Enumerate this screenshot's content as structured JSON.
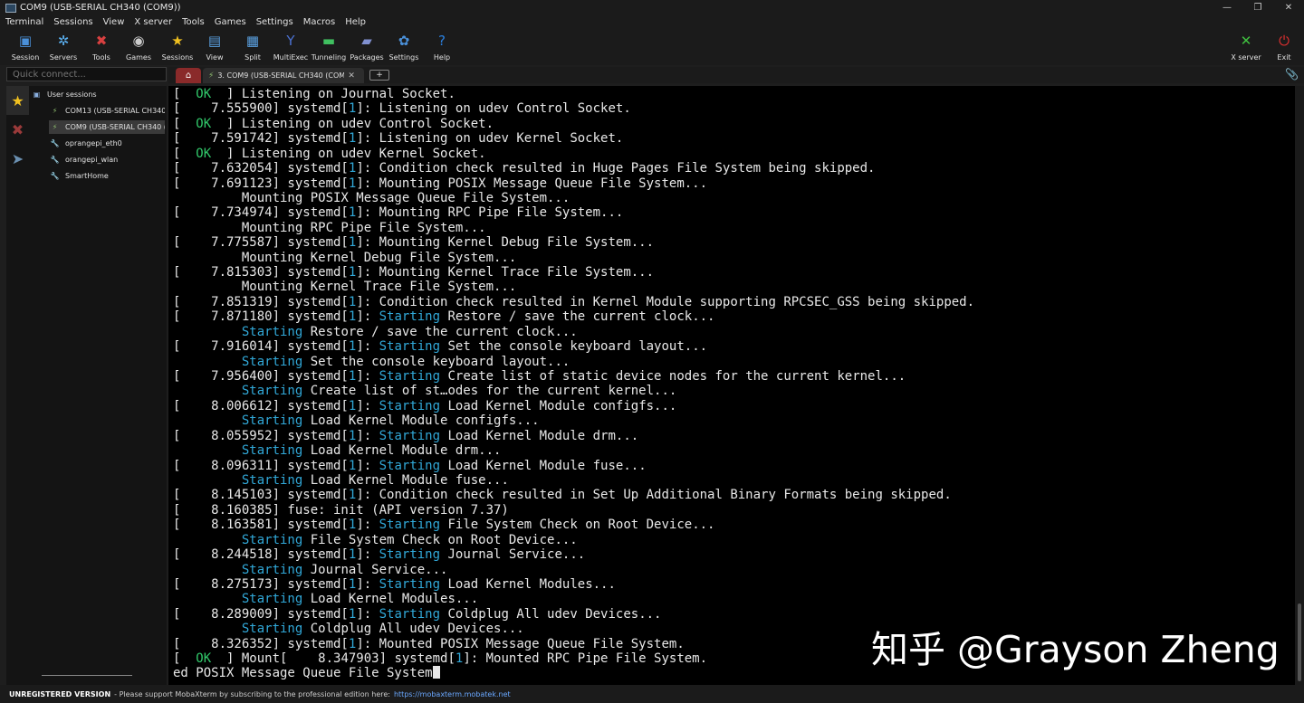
{
  "window": {
    "title": "COM9  (USB-SERIAL CH340 (COM9))",
    "controls": [
      "—",
      "❐",
      "✕"
    ]
  },
  "menu": [
    "Terminal",
    "Sessions",
    "View",
    "X server",
    "Tools",
    "Games",
    "Settings",
    "Macros",
    "Help"
  ],
  "toolbar": {
    "buttons": [
      {
        "label": "Session",
        "icon": "session-icon",
        "color": "#4a90d9",
        "glyph": "▣"
      },
      {
        "label": "Servers",
        "icon": "servers-icon",
        "color": "#5ab0f0",
        "glyph": "✲"
      },
      {
        "label": "Tools",
        "icon": "tools-icon",
        "color": "#d84040",
        "glyph": "✖"
      },
      {
        "label": "Games",
        "icon": "games-icon",
        "color": "#cccccc",
        "glyph": "◉"
      },
      {
        "label": "Sessions",
        "icon": "star-icon",
        "color": "#f0c020",
        "glyph": "★"
      },
      {
        "label": "View",
        "icon": "view-icon",
        "color": "#5aa0e0",
        "glyph": "▤"
      },
      {
        "label": "Split",
        "icon": "split-icon",
        "color": "#5aa0e0",
        "glyph": "▦"
      },
      {
        "label": "MultiExec",
        "icon": "multiexec-icon",
        "color": "#4a70d0",
        "glyph": "Y"
      },
      {
        "label": "Tunneling",
        "icon": "tunneling-icon",
        "color": "#40c060",
        "glyph": "▬"
      },
      {
        "label": "Packages",
        "icon": "packages-icon",
        "color": "#8090d0",
        "glyph": "▰"
      },
      {
        "label": "Settings",
        "icon": "settings-icon",
        "color": "#4a90d9",
        "glyph": "✿"
      },
      {
        "label": "Help",
        "icon": "help-icon",
        "color": "#2a80e0",
        "glyph": "?"
      }
    ],
    "right_buttons": [
      {
        "label": "X server",
        "icon": "xserver-icon",
        "color": "#40c040",
        "glyph": "✕"
      },
      {
        "label": "Exit",
        "icon": "exit-icon",
        "color": "#e03030",
        "glyph": "⏻"
      }
    ]
  },
  "sidebar": {
    "quick_connect_placeholder": "Quick connect...",
    "tabs": [
      {
        "name": "sidetab-sessions",
        "icon": "star-icon",
        "glyph": "★",
        "color": "#f0c020"
      },
      {
        "name": "sidetab-tools",
        "icon": "tools-icon",
        "glyph": "✖",
        "color": "#9a3a3a"
      },
      {
        "name": "sidetab-send",
        "icon": "send-icon",
        "glyph": "➤",
        "color": "#6a8fb0"
      }
    ],
    "tree": [
      {
        "label": "User sessions",
        "icon": "folder-icon",
        "glyph": "▣",
        "color": "#8ab0e0",
        "indent": 0
      },
      {
        "label": "COM13  (USB-SERIAL CH340 (COM13))",
        "icon": "serial-icon",
        "glyph": "⚡",
        "color": "#8fbf6f",
        "indent": 1
      },
      {
        "label": "COM9  (USB-SERIAL CH340 (COM9))",
        "icon": "serial-icon",
        "glyph": "⚡",
        "color": "#8fbf6f",
        "indent": 1,
        "selected": true
      },
      {
        "label": "oprangepi_eth0",
        "icon": "ssh-icon",
        "glyph": "🔧",
        "color": "#e0b030",
        "indent": 1
      },
      {
        "label": "orangepi_wlan",
        "icon": "ssh-icon",
        "glyph": "🔧",
        "color": "#e0b030",
        "indent": 1
      },
      {
        "label": "SmartHome",
        "icon": "ssh-icon",
        "glyph": "🔧",
        "color": "#e0b030",
        "indent": 1
      }
    ]
  },
  "tabs": {
    "session_tab_label": "3. COM9  (USB-SERIAL CH340 (COM9))",
    "close": "✕",
    "new_tab": "+"
  },
  "terminal": {
    "lines": [
      [
        {
          "t": "[  "
        },
        {
          "t": "OK",
          "c": "ok"
        },
        {
          "t": "  ] Listening on Journal Socket."
        }
      ],
      [
        {
          "t": "[    7.555900] systemd["
        },
        {
          "t": "1",
          "c": "num"
        },
        {
          "t": "]: Listening on udev Control Socket."
        }
      ],
      [
        {
          "t": "[  "
        },
        {
          "t": "OK",
          "c": "ok"
        },
        {
          "t": "  ] Listening on udev Control Socket."
        }
      ],
      [
        {
          "t": "[    7.591742] systemd["
        },
        {
          "t": "1",
          "c": "num"
        },
        {
          "t": "]: Listening on udev Kernel Socket."
        }
      ],
      [
        {
          "t": "[  "
        },
        {
          "t": "OK",
          "c": "ok"
        },
        {
          "t": "  ] Listening on udev Kernel Socket."
        }
      ],
      [
        {
          "t": "[    7.632054] systemd["
        },
        {
          "t": "1",
          "c": "num"
        },
        {
          "t": "]: Condition check resulted in Huge Pages File System being skipped."
        }
      ],
      [
        {
          "t": "[    7.691123] systemd["
        },
        {
          "t": "1",
          "c": "num"
        },
        {
          "t": "]: Mounting POSIX Message Queue File System..."
        }
      ],
      [
        {
          "t": "         Mounting POSIX Message Queue File System..."
        }
      ],
      [
        {
          "t": "[    7.734974] systemd["
        },
        {
          "t": "1",
          "c": "num"
        },
        {
          "t": "]: Mounting RPC Pipe File System..."
        }
      ],
      [
        {
          "t": "         Mounting RPC Pipe File System..."
        }
      ],
      [
        {
          "t": "[    7.775587] systemd["
        },
        {
          "t": "1",
          "c": "num"
        },
        {
          "t": "]: Mounting Kernel Debug File System..."
        }
      ],
      [
        {
          "t": "         Mounting Kernel Debug File System..."
        }
      ],
      [
        {
          "t": "[    7.815303] systemd["
        },
        {
          "t": "1",
          "c": "num"
        },
        {
          "t": "]: Mounting Kernel Trace File System..."
        }
      ],
      [
        {
          "t": "         Mounting Kernel Trace File System..."
        }
      ],
      [
        {
          "t": "[    7.851319] systemd["
        },
        {
          "t": "1",
          "c": "num"
        },
        {
          "t": "]: Condition check resulted in Kernel Module supporting RPCSEC_GSS being skipped."
        }
      ],
      [
        {
          "t": "[    7.871180] systemd["
        },
        {
          "t": "1",
          "c": "num"
        },
        {
          "t": "]: "
        },
        {
          "t": "Starting",
          "c": "cyan"
        },
        {
          "t": " Restore / save the current clock..."
        }
      ],
      [
        {
          "t": "         "
        },
        {
          "t": "Starting",
          "c": "cyan"
        },
        {
          "t": " Restore / save the current clock..."
        }
      ],
      [
        {
          "t": "[    7.916014] systemd["
        },
        {
          "t": "1",
          "c": "num"
        },
        {
          "t": "]: "
        },
        {
          "t": "Starting",
          "c": "cyan"
        },
        {
          "t": " Set the console keyboard layout..."
        }
      ],
      [
        {
          "t": "         "
        },
        {
          "t": "Starting",
          "c": "cyan"
        },
        {
          "t": " Set the console keyboard layout..."
        }
      ],
      [
        {
          "t": "[    7.956400] systemd["
        },
        {
          "t": "1",
          "c": "num"
        },
        {
          "t": "]: "
        },
        {
          "t": "Starting",
          "c": "cyan"
        },
        {
          "t": " Create list of static device nodes for the current kernel..."
        }
      ],
      [
        {
          "t": "         "
        },
        {
          "t": "Starting",
          "c": "cyan"
        },
        {
          "t": " Create list of st…odes for the current kernel..."
        }
      ],
      [
        {
          "t": "[    8.006612] systemd["
        },
        {
          "t": "1",
          "c": "num"
        },
        {
          "t": "]: "
        },
        {
          "t": "Starting",
          "c": "cyan"
        },
        {
          "t": " Load Kernel Module configfs..."
        }
      ],
      [
        {
          "t": "         "
        },
        {
          "t": "Starting",
          "c": "cyan"
        },
        {
          "t": " Load Kernel Module configfs..."
        }
      ],
      [
        {
          "t": "[    8.055952] systemd["
        },
        {
          "t": "1",
          "c": "num"
        },
        {
          "t": "]: "
        },
        {
          "t": "Starting",
          "c": "cyan"
        },
        {
          "t": " Load Kernel Module drm..."
        }
      ],
      [
        {
          "t": "         "
        },
        {
          "t": "Starting",
          "c": "cyan"
        },
        {
          "t": " Load Kernel Module drm..."
        }
      ],
      [
        {
          "t": "[    8.096311] systemd["
        },
        {
          "t": "1",
          "c": "num"
        },
        {
          "t": "]: "
        },
        {
          "t": "Starting",
          "c": "cyan"
        },
        {
          "t": " Load Kernel Module fuse..."
        }
      ],
      [
        {
          "t": "         "
        },
        {
          "t": "Starting",
          "c": "cyan"
        },
        {
          "t": " Load Kernel Module fuse..."
        }
      ],
      [
        {
          "t": "[    8.145103] systemd["
        },
        {
          "t": "1",
          "c": "num"
        },
        {
          "t": "]: Condition check resulted in Set Up Additional Binary Formats being skipped."
        }
      ],
      [
        {
          "t": "[    8.160385] fuse: init (API version 7.37)"
        }
      ],
      [
        {
          "t": "[    8.163581] systemd["
        },
        {
          "t": "1",
          "c": "num"
        },
        {
          "t": "]: "
        },
        {
          "t": "Starting",
          "c": "cyan"
        },
        {
          "t": " File System Check on Root Device..."
        }
      ],
      [
        {
          "t": "         "
        },
        {
          "t": "Starting",
          "c": "cyan"
        },
        {
          "t": " File System Check on Root Device..."
        }
      ],
      [
        {
          "t": "[    8.244518] systemd["
        },
        {
          "t": "1",
          "c": "num"
        },
        {
          "t": "]: "
        },
        {
          "t": "Starting",
          "c": "cyan"
        },
        {
          "t": " Journal Service..."
        }
      ],
      [
        {
          "t": "         "
        },
        {
          "t": "Starting",
          "c": "cyan"
        },
        {
          "t": " Journal Service..."
        }
      ],
      [
        {
          "t": "[    8.275173] systemd["
        },
        {
          "t": "1",
          "c": "num"
        },
        {
          "t": "]: "
        },
        {
          "t": "Starting",
          "c": "cyan"
        },
        {
          "t": " Load Kernel Modules..."
        }
      ],
      [
        {
          "t": "         "
        },
        {
          "t": "Starting",
          "c": "cyan"
        },
        {
          "t": " Load Kernel Modules..."
        }
      ],
      [
        {
          "t": "[    8.289009] systemd["
        },
        {
          "t": "1",
          "c": "num"
        },
        {
          "t": "]: "
        },
        {
          "t": "Starting",
          "c": "cyan"
        },
        {
          "t": " Coldplug All udev Devices..."
        }
      ],
      [
        {
          "t": "         "
        },
        {
          "t": "Starting",
          "c": "cyan"
        },
        {
          "t": " Coldplug All udev Devices..."
        }
      ],
      [
        {
          "t": "[    8.326352] systemd["
        },
        {
          "t": "1",
          "c": "num"
        },
        {
          "t": "]: Mounted POSIX Message Queue File System."
        }
      ],
      [
        {
          "t": "[  "
        },
        {
          "t": "OK",
          "c": "ok"
        },
        {
          "t": "  ] Mount[    8.347903] systemd["
        },
        {
          "t": "1",
          "c": "num"
        },
        {
          "t": "]: Mounted RPC Pipe File System."
        }
      ],
      [
        {
          "t": "ed POSIX Message Queue File System"
        }
      ]
    ]
  },
  "watermark": "知乎 @Grayson Zheng",
  "statusbar": {
    "unregistered": "UNREGISTERED VERSION",
    "message": "-  Please support MobaXterm by subscribing to the professional edition here:",
    "link": "https://mobaxterm.mobatek.net"
  },
  "colors": {
    "ok": "#31c86a",
    "cyan": "#31a8d8",
    "home_tab": "#8a2a2a"
  }
}
